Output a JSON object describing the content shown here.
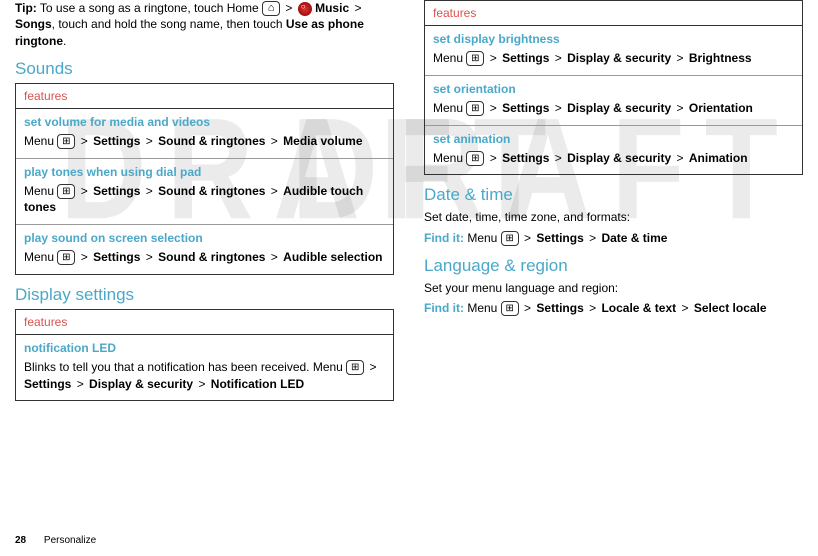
{
  "tip": {
    "label": "Tip:",
    "text1": "To use a song as a ringtone, touch Home",
    "text2": "Music",
    "text3": "Songs",
    "text4": ", touch and hold the song name, then touch",
    "text5": "Use as phone ringtone"
  },
  "sounds": {
    "heading": "Sounds",
    "features_label": "features",
    "rows": [
      {
        "title": "set volume for media and videos",
        "pre": "Menu",
        "p1": "Settings",
        "p2": "Sound & ringtones",
        "p3": "Media volume"
      },
      {
        "title": "play tones when using dial pad",
        "pre": "Menu",
        "p1": "Settings",
        "p2": "Sound & ringtones",
        "p3": "Audible touch tones"
      },
      {
        "title": "play sound on screen selection",
        "pre": "Menu",
        "p1": "Settings",
        "p2": "Sound & ringtones",
        "p3": "Audible selection"
      }
    ]
  },
  "display": {
    "heading": "Display settings",
    "features_label": "features",
    "row1": {
      "title": "notification LED",
      "desc": "Blinks to tell you that a notification has been received. Menu",
      "p1": "Settings",
      "p2": "Display & security",
      "p3": "Notification LED"
    },
    "rows": [
      {
        "title": "set display brightness",
        "pre": "Menu",
        "p1": "Settings",
        "p2": "Display & security",
        "p3": "Brightness"
      },
      {
        "title": "set orientation",
        "pre": "Menu",
        "p1": "Settings",
        "p2": "Display & security",
        "p3": "Orientation"
      },
      {
        "title": "set animation",
        "pre": "Menu",
        "p1": "Settings",
        "p2": "Display & security",
        "p3": "Animation"
      }
    ]
  },
  "datetime": {
    "heading": "Date & time",
    "desc": "Set date, time, time zone, and formats:",
    "find": "Find it:",
    "pre": "Menu",
    "p1": "Settings",
    "p2": "Date & time"
  },
  "lang": {
    "heading": "Language & region",
    "desc": "Set your menu language and region:",
    "find": "Find it:",
    "pre": "Menu",
    "p1": "Settings",
    "p2": "Locale & text",
    "p3": "Select locale"
  },
  "footer": {
    "page": "28",
    "section": "Personalize"
  }
}
